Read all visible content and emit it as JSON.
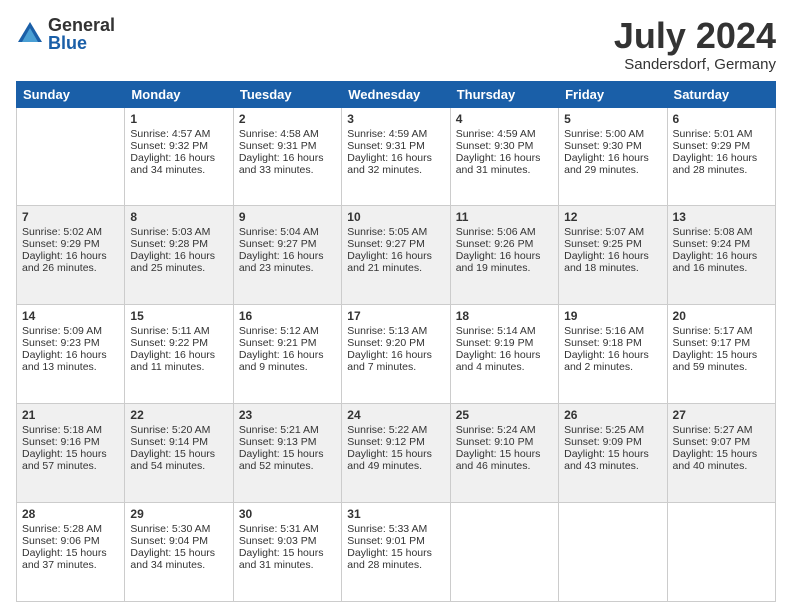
{
  "logo": {
    "general": "General",
    "blue": "Blue"
  },
  "title": "July 2024",
  "subtitle": "Sandersdorf, Germany",
  "days": [
    "Sunday",
    "Monday",
    "Tuesday",
    "Wednesday",
    "Thursday",
    "Friday",
    "Saturday"
  ],
  "weeks": [
    [
      {
        "day": "",
        "sunrise": "",
        "sunset": "",
        "daylight": ""
      },
      {
        "day": "1",
        "sunrise": "Sunrise: 4:57 AM",
        "sunset": "Sunset: 9:32 PM",
        "daylight": "Daylight: 16 hours and 34 minutes."
      },
      {
        "day": "2",
        "sunrise": "Sunrise: 4:58 AM",
        "sunset": "Sunset: 9:31 PM",
        "daylight": "Daylight: 16 hours and 33 minutes."
      },
      {
        "day": "3",
        "sunrise": "Sunrise: 4:59 AM",
        "sunset": "Sunset: 9:31 PM",
        "daylight": "Daylight: 16 hours and 32 minutes."
      },
      {
        "day": "4",
        "sunrise": "Sunrise: 4:59 AM",
        "sunset": "Sunset: 9:30 PM",
        "daylight": "Daylight: 16 hours and 31 minutes."
      },
      {
        "day": "5",
        "sunrise": "Sunrise: 5:00 AM",
        "sunset": "Sunset: 9:30 PM",
        "daylight": "Daylight: 16 hours and 29 minutes."
      },
      {
        "day": "6",
        "sunrise": "Sunrise: 5:01 AM",
        "sunset": "Sunset: 9:29 PM",
        "daylight": "Daylight: 16 hours and 28 minutes."
      }
    ],
    [
      {
        "day": "7",
        "sunrise": "Sunrise: 5:02 AM",
        "sunset": "Sunset: 9:29 PM",
        "daylight": "Daylight: 16 hours and 26 minutes."
      },
      {
        "day": "8",
        "sunrise": "Sunrise: 5:03 AM",
        "sunset": "Sunset: 9:28 PM",
        "daylight": "Daylight: 16 hours and 25 minutes."
      },
      {
        "day": "9",
        "sunrise": "Sunrise: 5:04 AM",
        "sunset": "Sunset: 9:27 PM",
        "daylight": "Daylight: 16 hours and 23 minutes."
      },
      {
        "day": "10",
        "sunrise": "Sunrise: 5:05 AM",
        "sunset": "Sunset: 9:27 PM",
        "daylight": "Daylight: 16 hours and 21 minutes."
      },
      {
        "day": "11",
        "sunrise": "Sunrise: 5:06 AM",
        "sunset": "Sunset: 9:26 PM",
        "daylight": "Daylight: 16 hours and 19 minutes."
      },
      {
        "day": "12",
        "sunrise": "Sunrise: 5:07 AM",
        "sunset": "Sunset: 9:25 PM",
        "daylight": "Daylight: 16 hours and 18 minutes."
      },
      {
        "day": "13",
        "sunrise": "Sunrise: 5:08 AM",
        "sunset": "Sunset: 9:24 PM",
        "daylight": "Daylight: 16 hours and 16 minutes."
      }
    ],
    [
      {
        "day": "14",
        "sunrise": "Sunrise: 5:09 AM",
        "sunset": "Sunset: 9:23 PM",
        "daylight": "Daylight: 16 hours and 13 minutes."
      },
      {
        "day": "15",
        "sunrise": "Sunrise: 5:11 AM",
        "sunset": "Sunset: 9:22 PM",
        "daylight": "Daylight: 16 hours and 11 minutes."
      },
      {
        "day": "16",
        "sunrise": "Sunrise: 5:12 AM",
        "sunset": "Sunset: 9:21 PM",
        "daylight": "Daylight: 16 hours and 9 minutes."
      },
      {
        "day": "17",
        "sunrise": "Sunrise: 5:13 AM",
        "sunset": "Sunset: 9:20 PM",
        "daylight": "Daylight: 16 hours and 7 minutes."
      },
      {
        "day": "18",
        "sunrise": "Sunrise: 5:14 AM",
        "sunset": "Sunset: 9:19 PM",
        "daylight": "Daylight: 16 hours and 4 minutes."
      },
      {
        "day": "19",
        "sunrise": "Sunrise: 5:16 AM",
        "sunset": "Sunset: 9:18 PM",
        "daylight": "Daylight: 16 hours and 2 minutes."
      },
      {
        "day": "20",
        "sunrise": "Sunrise: 5:17 AM",
        "sunset": "Sunset: 9:17 PM",
        "daylight": "Daylight: 15 hours and 59 minutes."
      }
    ],
    [
      {
        "day": "21",
        "sunrise": "Sunrise: 5:18 AM",
        "sunset": "Sunset: 9:16 PM",
        "daylight": "Daylight: 15 hours and 57 minutes."
      },
      {
        "day": "22",
        "sunrise": "Sunrise: 5:20 AM",
        "sunset": "Sunset: 9:14 PM",
        "daylight": "Daylight: 15 hours and 54 minutes."
      },
      {
        "day": "23",
        "sunrise": "Sunrise: 5:21 AM",
        "sunset": "Sunset: 9:13 PM",
        "daylight": "Daylight: 15 hours and 52 minutes."
      },
      {
        "day": "24",
        "sunrise": "Sunrise: 5:22 AM",
        "sunset": "Sunset: 9:12 PM",
        "daylight": "Daylight: 15 hours and 49 minutes."
      },
      {
        "day": "25",
        "sunrise": "Sunrise: 5:24 AM",
        "sunset": "Sunset: 9:10 PM",
        "daylight": "Daylight: 15 hours and 46 minutes."
      },
      {
        "day": "26",
        "sunrise": "Sunrise: 5:25 AM",
        "sunset": "Sunset: 9:09 PM",
        "daylight": "Daylight: 15 hours and 43 minutes."
      },
      {
        "day": "27",
        "sunrise": "Sunrise: 5:27 AM",
        "sunset": "Sunset: 9:07 PM",
        "daylight": "Daylight: 15 hours and 40 minutes."
      }
    ],
    [
      {
        "day": "28",
        "sunrise": "Sunrise: 5:28 AM",
        "sunset": "Sunset: 9:06 PM",
        "daylight": "Daylight: 15 hours and 37 minutes."
      },
      {
        "day": "29",
        "sunrise": "Sunrise: 5:30 AM",
        "sunset": "Sunset: 9:04 PM",
        "daylight": "Daylight: 15 hours and 34 minutes."
      },
      {
        "day": "30",
        "sunrise": "Sunrise: 5:31 AM",
        "sunset": "Sunset: 9:03 PM",
        "daylight": "Daylight: 15 hours and 31 minutes."
      },
      {
        "day": "31",
        "sunrise": "Sunrise: 5:33 AM",
        "sunset": "Sunset: 9:01 PM",
        "daylight": "Daylight: 15 hours and 28 minutes."
      },
      {
        "day": "",
        "sunrise": "",
        "sunset": "",
        "daylight": ""
      },
      {
        "day": "",
        "sunrise": "",
        "sunset": "",
        "daylight": ""
      },
      {
        "day": "",
        "sunrise": "",
        "sunset": "",
        "daylight": ""
      }
    ]
  ]
}
